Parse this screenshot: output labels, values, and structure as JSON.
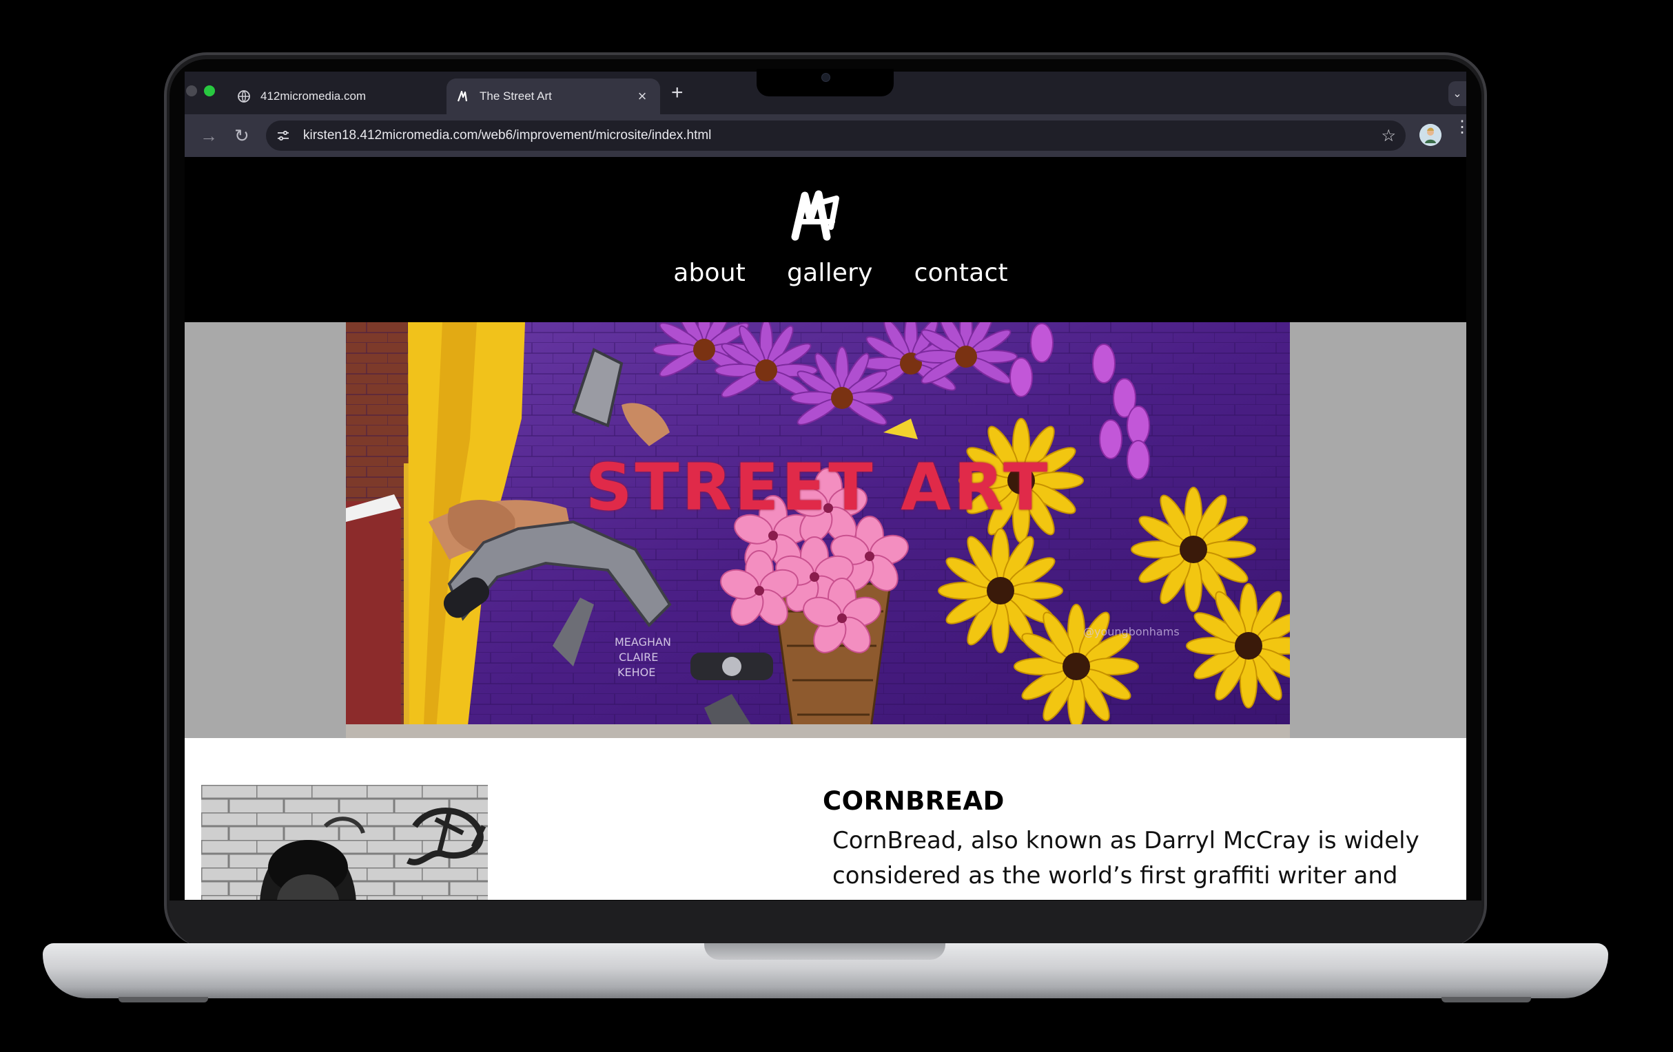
{
  "browser": {
    "tabs": [
      {
        "label": "412micromedia.com",
        "active": false,
        "icon": "globe-icon"
      },
      {
        "label": "The Street Art",
        "active": true,
        "icon": "site-logo-icon"
      }
    ],
    "close_glyph": "×",
    "new_tab_glyph": "+",
    "tab_menu_glyph": "⌄",
    "address": "kirsten18.412micromedia.com/web6/improvement/microsite/index.html",
    "star_glyph": "☆",
    "forward_glyph": "→",
    "reload_glyph": "↻",
    "menu_glyph": "⋮"
  },
  "site": {
    "nav": [
      "about",
      "gallery",
      "contact"
    ],
    "hero_title": "STREET ART",
    "artist": {
      "name": "CORNBREAD",
      "bio": "CornBread, also known as Darryl McCray is widely considered as the world’s first graffiti writer and"
    }
  },
  "colors": {
    "hero_title": "#e02a49",
    "hero_band": "#a9a9a9",
    "tab_active": "#353542",
    "tab_strip": "#1f1f28"
  }
}
